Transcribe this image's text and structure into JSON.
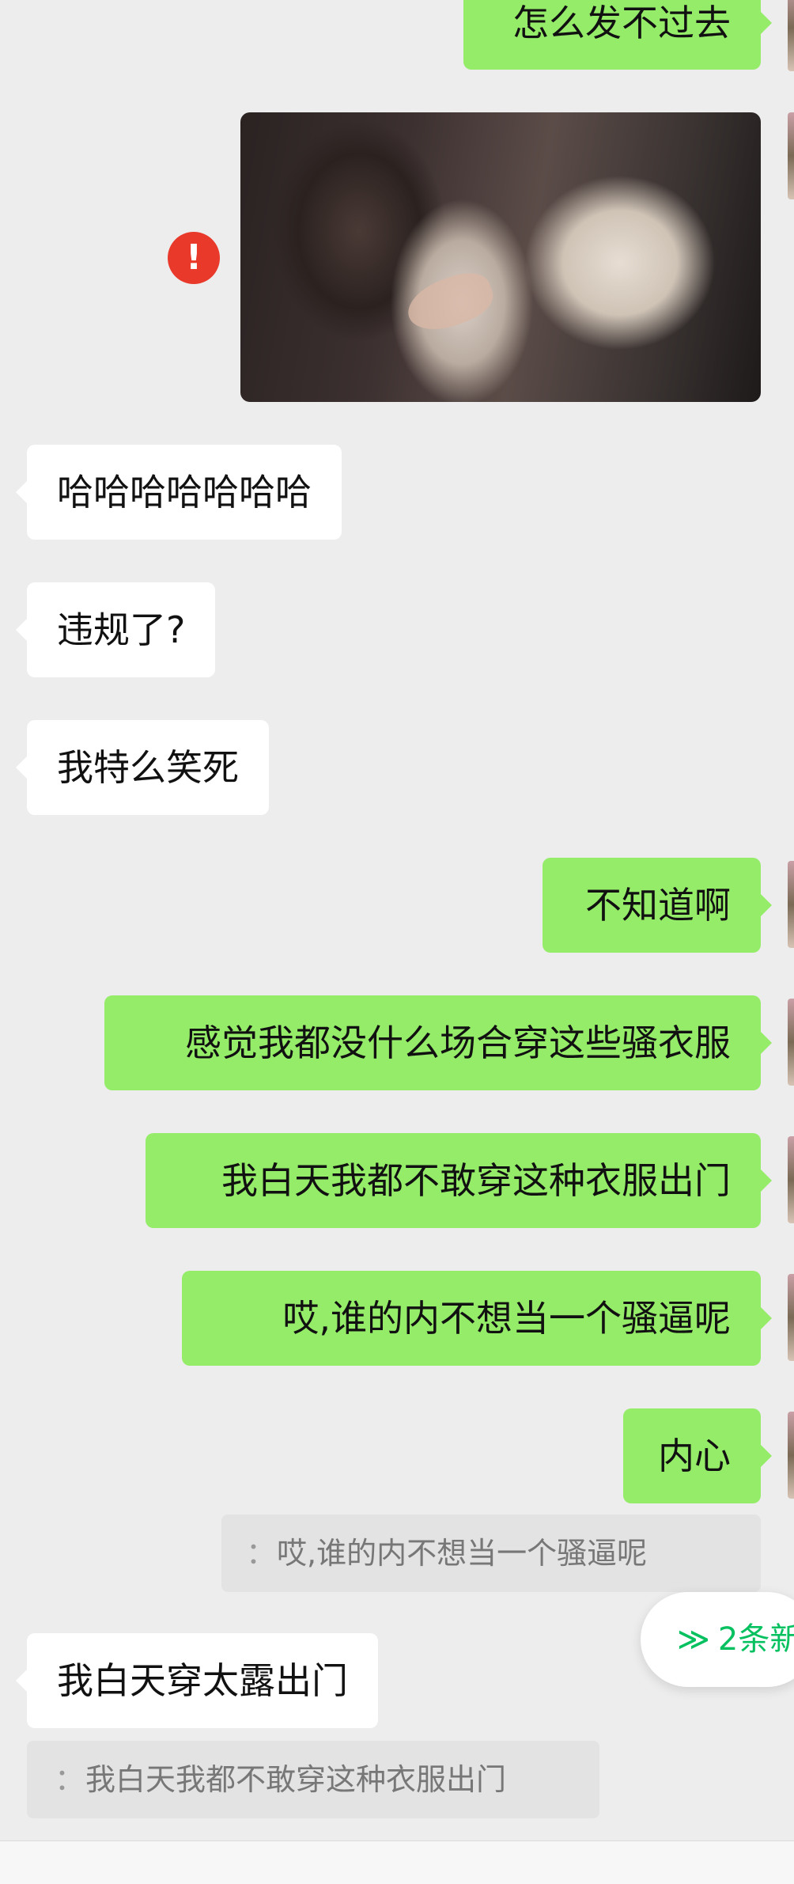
{
  "messages": [
    {
      "side": "out",
      "text": "怎么发不过去"
    },
    {
      "side": "out",
      "type": "image",
      "failed": true,
      "error_glyph": "!"
    },
    {
      "side": "in",
      "text": "哈哈哈哈哈哈哈"
    },
    {
      "side": "in",
      "text": "违规了?"
    },
    {
      "side": "in",
      "text": "我特么笑死"
    },
    {
      "side": "out",
      "text": "不知道啊"
    },
    {
      "side": "out",
      "text": "感觉我都没什么场合穿这些骚衣服"
    },
    {
      "side": "out",
      "text": "我白天我都不敢穿这种衣服出门"
    },
    {
      "side": "out",
      "text": "哎,谁的内不想当一个骚逼呢"
    },
    {
      "side": "out",
      "text": "内心"
    },
    {
      "side": "in",
      "text": "我白天穿太露出门"
    }
  ],
  "quotes": [
    {
      "text": "哎,谁的内不想当一个骚逼呢",
      "prefix": "："
    },
    {
      "text": "我白天我都不敢穿这种衣服出门",
      "prefix": "："
    }
  ],
  "new_message_pill": {
    "icon": "chevrons-down-icon",
    "chevron_glyph": "≫",
    "text": "2条新"
  },
  "colors": {
    "background": "#ededed",
    "outgoing_bubble": "#95ec69",
    "incoming_bubble": "#ffffff",
    "error": "#e8392b",
    "accent": "#07c160"
  }
}
